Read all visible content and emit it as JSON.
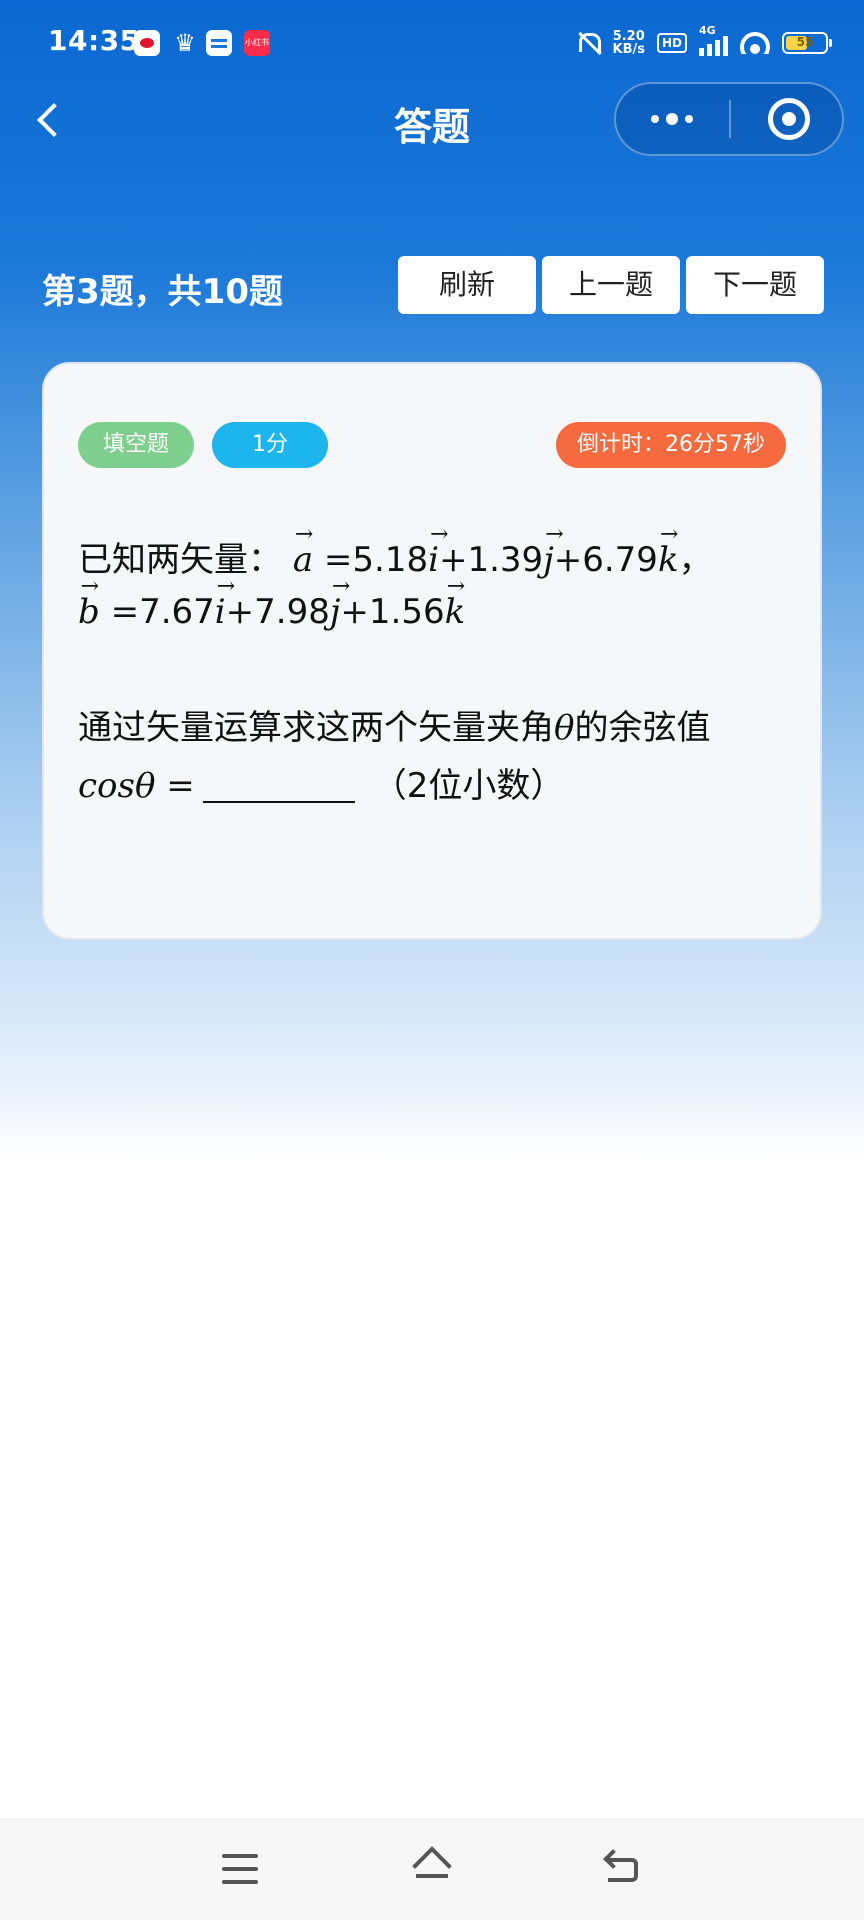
{
  "status_bar": {
    "time": "14:35",
    "net_speed_value": "5.20",
    "net_speed_unit": "KB/s",
    "hd": "HD",
    "network": "4G",
    "battery": "55",
    "battery_level": 0.55,
    "app_icon_text": "小红书",
    "icons": [
      "weibo-icon",
      "crown-icon",
      "card-icon",
      "app-icon",
      "bell-muted-icon",
      "signal-icon",
      "wifi-icon",
      "battery-icon"
    ]
  },
  "nav": {
    "title": "答题"
  },
  "header": {
    "progress": "第3题，共10题",
    "refresh_label": "刷新",
    "prev_label": "上一题",
    "next_label": "下一题"
  },
  "question": {
    "type": "填空题",
    "score": "1分",
    "timer": "倒计时：26分57秒",
    "intro": "已知两矢量：",
    "vec_a": "a",
    "vec_b": "b",
    "unit_i": "i",
    "unit_j": "j",
    "unit_k": "k",
    "eq": "=",
    "plus": "+",
    "a_i": "5.18",
    "a_j": "1.39",
    "a_k": "6.79",
    "b_i": "7.67",
    "b_j": "7.98",
    "b_k": "1.56",
    "comma": "，",
    "prompt_pre": "通过矢量运算求这两个矢量夹角",
    "theta": "θ",
    "prompt_post": "的余弦值",
    "cos_label": "cosθ =",
    "hint": "（2位小数）"
  },
  "colors": {
    "header_blue": "#0a68d2",
    "tag_type": "#7ecf8e",
    "tag_score": "#1cb5ee",
    "tag_timer": "#f56a3f"
  }
}
